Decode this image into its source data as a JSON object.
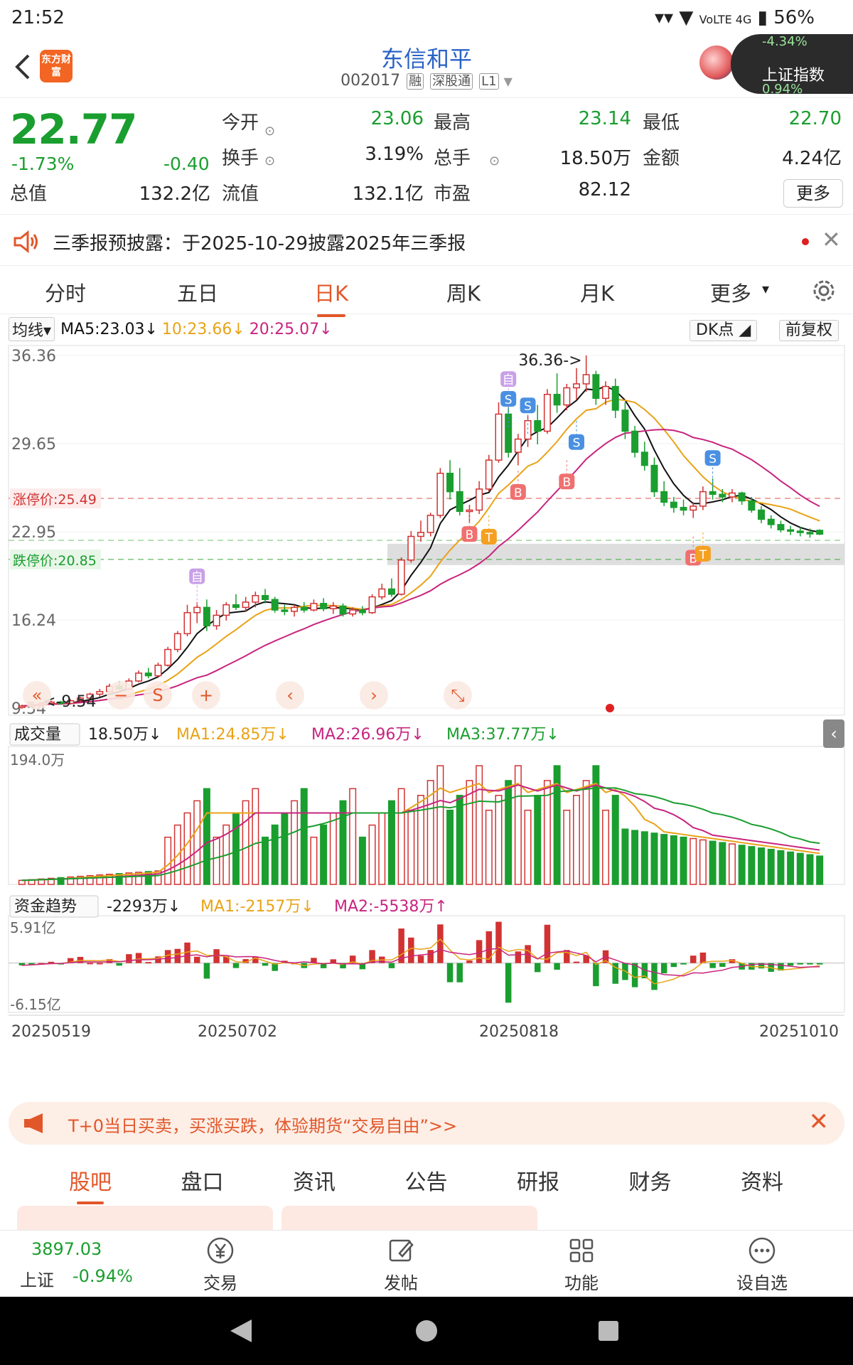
{
  "status_bar": {
    "time": "21:52",
    "signal_text": "VoLTE 4G",
    "battery": "56%"
  },
  "header": {
    "logo_text": "东方财富",
    "stock_name": "东信和平",
    "stock_code": "002017",
    "tags": [
      "融",
      "深股通",
      "L1"
    ],
    "index_float_label": "上证指数",
    "index_float_top": "-4.34%",
    "index_float_bottom": "0.94%"
  },
  "quote": {
    "price": "22.77",
    "change_pct": "-1.73%",
    "change_abs": "-0.40",
    "fields": [
      {
        "label": "今开",
        "value": "23.06",
        "color": "#1a9e2f"
      },
      {
        "label": "最高",
        "value": "23.14",
        "color": "#1a9e2f"
      },
      {
        "label": "最低",
        "value": "22.70",
        "color": "#1a9e2f"
      },
      {
        "label": "换手",
        "value": "3.19%",
        "color": "#222222"
      },
      {
        "label": "总手",
        "value": "18.50万",
        "color": "#222222"
      },
      {
        "label": "金额",
        "value": "4.24亿",
        "color": "#222222"
      },
      {
        "label": "总值",
        "value": "132.2亿",
        "color": "#222222"
      },
      {
        "label": "流值",
        "value": "132.1亿",
        "color": "#222222"
      },
      {
        "label": "市盈",
        "value": "82.12",
        "color": "#222222"
      }
    ],
    "more_label": "更多"
  },
  "notice": {
    "text": "三季报预披露：于2025-10-29披露2025年三季报"
  },
  "period_tabs": [
    "分时",
    "五日",
    "日K",
    "周K",
    "月K",
    "更多"
  ],
  "active_period": "日K",
  "ma_legend": {
    "selector": "均线",
    "ma5": "MA5:23.03↓",
    "ma10": "10:23.66↓",
    "ma20": "20:25.07↓",
    "dk_button": "DK点",
    "adjust_button": "前复权"
  },
  "price_chart": {
    "y_labels": [
      "36.36",
      "29.65",
      "22.95",
      "16.24",
      "9.54"
    ],
    "high_marker": "36.36->",
    "low_marker": "<-9.54",
    "limit_up_label": "涨停价:25.49",
    "limit_down_label": "跌停价:20.85",
    "markers": {
      "self": "自",
      "sell": "S",
      "buy": "B",
      "t": "T"
    }
  },
  "volume_legend": {
    "selector": "成交量",
    "current": "18.50万↓",
    "ma1": "MA1:24.85万↓",
    "ma2": "MA2:26.96万↓",
    "ma3": "MA3:37.77万↓",
    "max_label": "194.0万"
  },
  "fund_legend": {
    "selector": "资金趋势",
    "current": "-2293万↓",
    "ma1": "MA1:-2157万↓",
    "ma2": "MA2:-5538万↑",
    "max_label": "5.91亿",
    "min_label": "-6.15亿"
  },
  "date_axis": [
    "20250519",
    "20250702",
    "20250818",
    "20251010"
  ],
  "colors": {
    "up": "#d23232",
    "down": "#1a9e2f",
    "accent": "#e2572a",
    "ma5": "#111111",
    "ma10": "#e8a317",
    "ma20": "#c8247f",
    "ma3": "#1a9e2f"
  },
  "chart_data": {
    "type": "candlestick",
    "candles_ohlc": [
      [
        9.6,
        9.8,
        9.5,
        9.7
      ],
      [
        9.7,
        9.9,
        9.6,
        9.8
      ],
      [
        9.8,
        10.0,
        9.7,
        9.9
      ],
      [
        9.9,
        10.1,
        9.8,
        10.0
      ],
      [
        10.0,
        10.1,
        9.8,
        9.9
      ],
      [
        9.9,
        10.2,
        9.8,
        10.1
      ],
      [
        10.1,
        10.4,
        10.0,
        10.3
      ],
      [
        10.3,
        10.7,
        10.2,
        10.6
      ],
      [
        10.6,
        11.0,
        10.4,
        10.8
      ],
      [
        10.8,
        11.4,
        10.7,
        11.2
      ],
      [
        11.2,
        11.6,
        10.9,
        11.0
      ],
      [
        11.0,
        11.8,
        10.9,
        11.6
      ],
      [
        11.6,
        12.4,
        11.5,
        12.2
      ],
      [
        12.2,
        12.6,
        11.8,
        12.0
      ],
      [
        12.0,
        13.0,
        11.9,
        12.8
      ],
      [
        12.8,
        14.2,
        12.7,
        14.0
      ],
      [
        14.0,
        15.4,
        13.8,
        15.2
      ],
      [
        15.2,
        17.4,
        15.0,
        16.8
      ],
      [
        16.8,
        17.6,
        16.0,
        17.2
      ],
      [
        17.2,
        17.8,
        15.4,
        15.8
      ],
      [
        15.8,
        17.0,
        15.5,
        16.6
      ],
      [
        16.6,
        17.6,
        16.2,
        17.4
      ],
      [
        17.4,
        18.2,
        17.0,
        17.2
      ],
      [
        17.2,
        18.0,
        16.9,
        17.6
      ],
      [
        17.6,
        18.4,
        17.2,
        18.1
      ],
      [
        18.1,
        18.6,
        17.5,
        17.8
      ],
      [
        17.8,
        18.0,
        16.8,
        17.0
      ],
      [
        17.0,
        17.4,
        16.6,
        16.9
      ],
      [
        16.9,
        17.4,
        16.5,
        17.2
      ],
      [
        17.2,
        17.6,
        16.8,
        17.0
      ],
      [
        17.0,
        17.8,
        16.9,
        17.5
      ],
      [
        17.5,
        17.9,
        16.9,
        17.1
      ],
      [
        17.1,
        17.6,
        16.7,
        17.3
      ],
      [
        17.3,
        17.5,
        16.5,
        16.7
      ],
      [
        16.7,
        17.2,
        16.5,
        17.0
      ],
      [
        17.0,
        17.3,
        16.6,
        16.8
      ],
      [
        16.8,
        18.2,
        16.7,
        18.0
      ],
      [
        18.0,
        19.0,
        17.8,
        18.6
      ],
      [
        18.6,
        19.4,
        18.0,
        18.2
      ],
      [
        18.2,
        21.0,
        18.1,
        20.8
      ],
      [
        20.8,
        23.0,
        20.6,
        22.6
      ],
      [
        22.6,
        23.8,
        22.2,
        22.9
      ],
      [
        22.9,
        24.4,
        22.6,
        24.2
      ],
      [
        24.2,
        27.8,
        24.0,
        27.4
      ],
      [
        27.4,
        28.4,
        25.4,
        26.0
      ],
      [
        26.0,
        27.8,
        24.2,
        24.5
      ],
      [
        24.5,
        25.0,
        23.6,
        24.6
      ],
      [
        24.6,
        26.8,
        24.3,
        26.2
      ],
      [
        26.2,
        28.8,
        26.0,
        28.4
      ],
      [
        28.4,
        32.8,
        28.2,
        31.9
      ],
      [
        31.9,
        33.0,
        28.6,
        29.0
      ],
      [
        29.0,
        30.4,
        28.0,
        30.0
      ],
      [
        30.0,
        31.8,
        29.4,
        31.4
      ],
      [
        31.4,
        32.6,
        29.6,
        30.6
      ],
      [
        30.6,
        33.8,
        30.4,
        33.4
      ],
      [
        33.4,
        35.0,
        32.0,
        32.6
      ],
      [
        32.6,
        34.2,
        32.2,
        33.9
      ],
      [
        33.9,
        35.4,
        33.0,
        34.2
      ],
      [
        34.2,
        36.36,
        33.6,
        34.9
      ],
      [
        34.9,
        35.2,
        32.6,
        33.1
      ],
      [
        33.1,
        34.4,
        32.6,
        34.0
      ],
      [
        34.0,
        34.6,
        31.6,
        32.2
      ],
      [
        32.2,
        32.8,
        30.0,
        30.6
      ],
      [
        30.6,
        31.0,
        28.6,
        29.0
      ],
      [
        29.0,
        29.8,
        27.6,
        28.0
      ],
      [
        28.0,
        28.6,
        25.6,
        26.0
      ],
      [
        26.0,
        26.8,
        24.9,
        25.2
      ],
      [
        25.2,
        25.6,
        24.4,
        24.8
      ],
      [
        24.8,
        25.4,
        24.2,
        24.6
      ],
      [
        24.6,
        25.2,
        24.0,
        24.9
      ],
      [
        24.9,
        26.4,
        24.6,
        26.0
      ],
      [
        26.0,
        27.0,
        25.4,
        25.8
      ],
      [
        25.8,
        26.2,
        25.2,
        25.6
      ],
      [
        25.6,
        26.2,
        25.2,
        25.9
      ],
      [
        25.9,
        26.0,
        25.0,
        25.3
      ],
      [
        25.3,
        25.6,
        24.4,
        24.6
      ],
      [
        24.6,
        24.9,
        23.6,
        23.9
      ],
      [
        23.9,
        24.2,
        23.2,
        23.5
      ],
      [
        23.5,
        23.8,
        22.9,
        23.1
      ],
      [
        23.1,
        23.4,
        22.7,
        23.0
      ],
      [
        23.0,
        23.3,
        22.6,
        22.9
      ],
      [
        22.9,
        23.2,
        22.5,
        22.8
      ],
      [
        23.06,
        23.14,
        22.7,
        22.77
      ]
    ],
    "y_range": [
      9.54,
      36.36
    ],
    "volume_range": [
      0,
      194.0
    ],
    "fund_range": [
      -6.15,
      5.91
    ]
  },
  "promo": {
    "text": "T+0当日买卖，买涨买跌，体验期货“交易自由”>>"
  },
  "content_tabs": [
    "股吧",
    "盘口",
    "资讯",
    "公告",
    "研报",
    "财务",
    "资料"
  ],
  "active_content_tab": "股吧",
  "bottom_nav": {
    "index_value": "3897.03",
    "index_label": "上证",
    "index_change": "-0.94%",
    "items": [
      "交易",
      "发帖",
      "功能",
      "设自选"
    ]
  }
}
